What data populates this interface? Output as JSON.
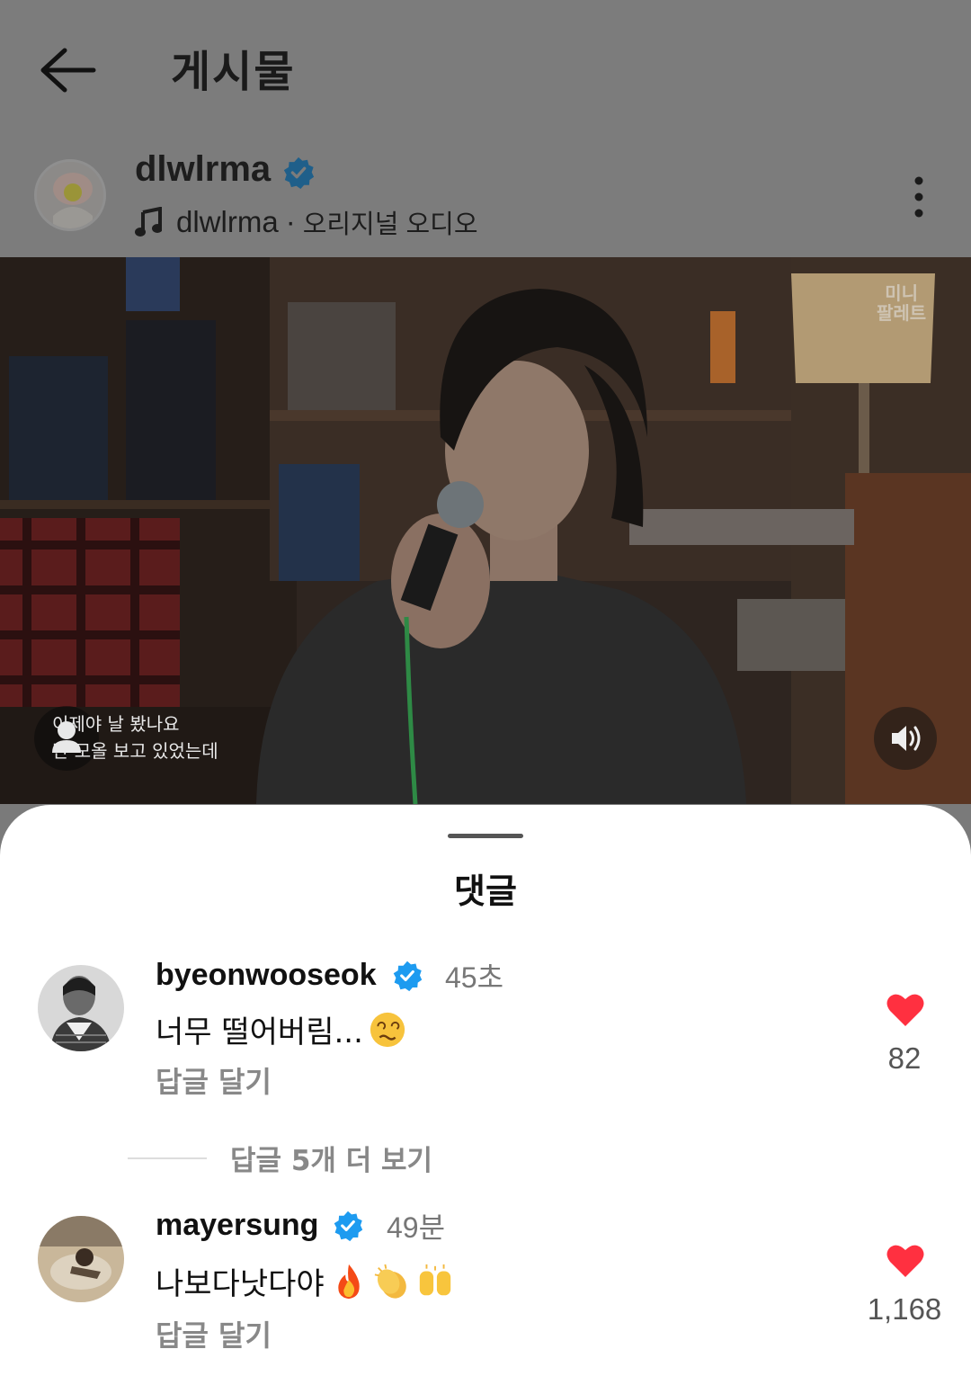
{
  "header": {
    "title": "게시물"
  },
  "post": {
    "username": "dlwlrma",
    "audio_artist": "dlwlrma",
    "audio_separator": "·",
    "audio_name": "오리지널 오디오"
  },
  "video": {
    "watermark_line1": "미니",
    "watermark_line2": "팔레트",
    "lyrics_line1": "이제야 날 봤나요",
    "lyrics_line2": "난 모올 보고 있었는데"
  },
  "comments_sheet": {
    "title": "댓글",
    "comments": [
      {
        "username": "byeonwooseok",
        "time": "45초",
        "text": "너무 떨어버림...",
        "emojis": [
          "woozy-face"
        ],
        "reply_label": "답글 달기",
        "likes": "82"
      },
      {
        "username": "mayersung",
        "time": "49분",
        "text": "나보다낫다야",
        "emojis": [
          "fire",
          "clapping-hands",
          "raising-hands"
        ],
        "reply_label": "답글 달기",
        "likes": "1,168"
      }
    ],
    "view_more_replies": "답글 5개 더 보기"
  },
  "colors": {
    "verified": "#1d9bf0",
    "heart": "#ff3040",
    "dim_overlay": "#7c7c7c"
  }
}
